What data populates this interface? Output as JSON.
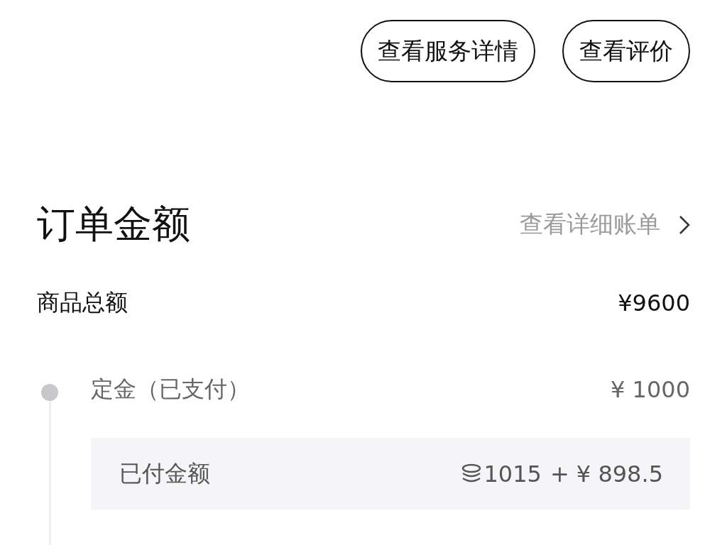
{
  "actions": [
    "查看服务详情",
    "查看评价"
  ],
  "order_amount": {
    "title": "订单金额",
    "link": "查看详细账单"
  },
  "goods_total": {
    "label": "商品总额",
    "value": "¥9600"
  },
  "deposit": {
    "label": "定金（已支付）",
    "value": "¥ 1000"
  },
  "paid": {
    "label": "已付金额",
    "coins": "1015",
    "value": "+ ¥ 898.5"
  }
}
